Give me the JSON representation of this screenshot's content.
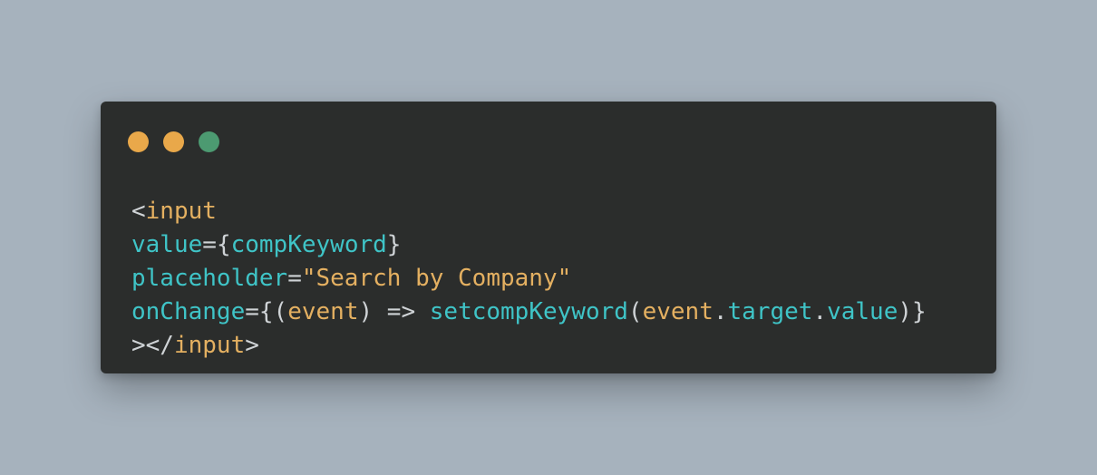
{
  "window_controls": [
    {
      "name": "close",
      "color": "#e9a84a"
    },
    {
      "name": "minimize",
      "color": "#e9a84a"
    },
    {
      "name": "maximize",
      "color": "#4c9a71"
    }
  ],
  "colors": {
    "background": "#a6b2bd",
    "editor_background": "#2b2d2c",
    "punctuation": "#cfd3d6",
    "tag": "#e4b061",
    "attribute": "#3fc4c7",
    "string": "#e4b061",
    "function": "#3fc4c7"
  },
  "code": {
    "line1": {
      "open": "<",
      "tag": "input"
    },
    "line2": {
      "attr": "value",
      "eq": "=",
      "lbrace": "{",
      "expr": "compKeyword",
      "rbrace": "}"
    },
    "line3": {
      "attr": "placeholder",
      "eq": "=",
      "string": "\"Search by Company\""
    },
    "line4": {
      "attr": "onChange",
      "eq": "=",
      "lbrace": "{",
      "lparen": "(",
      "param": "event",
      "rparen": ")",
      "arrow": " => ",
      "func": "setcompKeyword",
      "call_open": "(",
      "obj": "event",
      "dot1": ".",
      "prop1": "target",
      "dot2": ".",
      "prop2": "value",
      "call_close": ")",
      "rbrace": "}"
    },
    "line5": {
      "close_open": "></",
      "tag": "input",
      "close": ">"
    }
  }
}
